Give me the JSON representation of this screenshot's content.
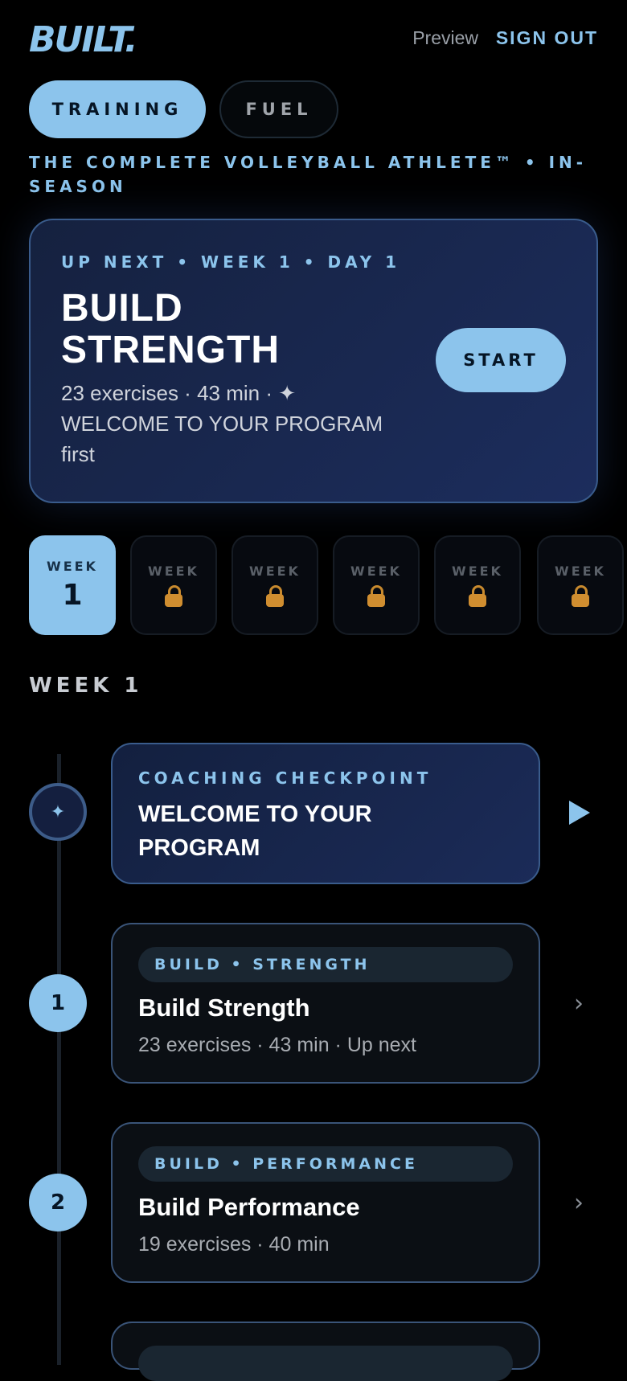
{
  "header": {
    "logo": "BUILT.",
    "preview_label": "Preview",
    "signout_label": "SIGN OUT"
  },
  "tabs": [
    {
      "label": "TRAINING",
      "active": true
    },
    {
      "label": "FUEL",
      "active": false
    }
  ],
  "program_title": "THE COMPLETE VOLLEYBALL ATHLETE™ • IN-SEASON",
  "hero": {
    "eyebrow": "UP NEXT • WEEK 1 • DAY 1",
    "title": "BUILD STRENGTH",
    "meta": "23 exercises · 43 min · ✦ WELCOME TO YOUR PROGRAM first",
    "start_label": "START"
  },
  "weeks": [
    {
      "label": "WEEK",
      "number": "1",
      "locked": false,
      "active": true
    },
    {
      "label": "WEEK",
      "locked": true,
      "active": false
    },
    {
      "label": "WEEK",
      "locked": true,
      "active": false
    },
    {
      "label": "WEEK",
      "locked": true,
      "active": false
    },
    {
      "label": "WEEK",
      "locked": true,
      "active": false
    },
    {
      "label": "WEEK",
      "locked": true,
      "active": false
    }
  ],
  "section_label": "WEEK 1",
  "checkpoint": {
    "eyebrow": "COACHING CHECKPOINT",
    "title": "WELCOME TO YOUR PROGRAM",
    "icon": "sparkle-icon"
  },
  "days": [
    {
      "number": "1",
      "tag": "BUILD • STRENGTH",
      "title": "Build Strength",
      "meta": "23 exercises · 43 min · Up next"
    },
    {
      "number": "2",
      "tag": "BUILD • PERFORMANCE",
      "title": "Build Performance",
      "meta": "19 exercises · 40 min"
    }
  ],
  "colors": {
    "accent": "#8cc4ec",
    "background": "#000000",
    "lock": "#d08e30",
    "card_border": "#3a5478"
  }
}
